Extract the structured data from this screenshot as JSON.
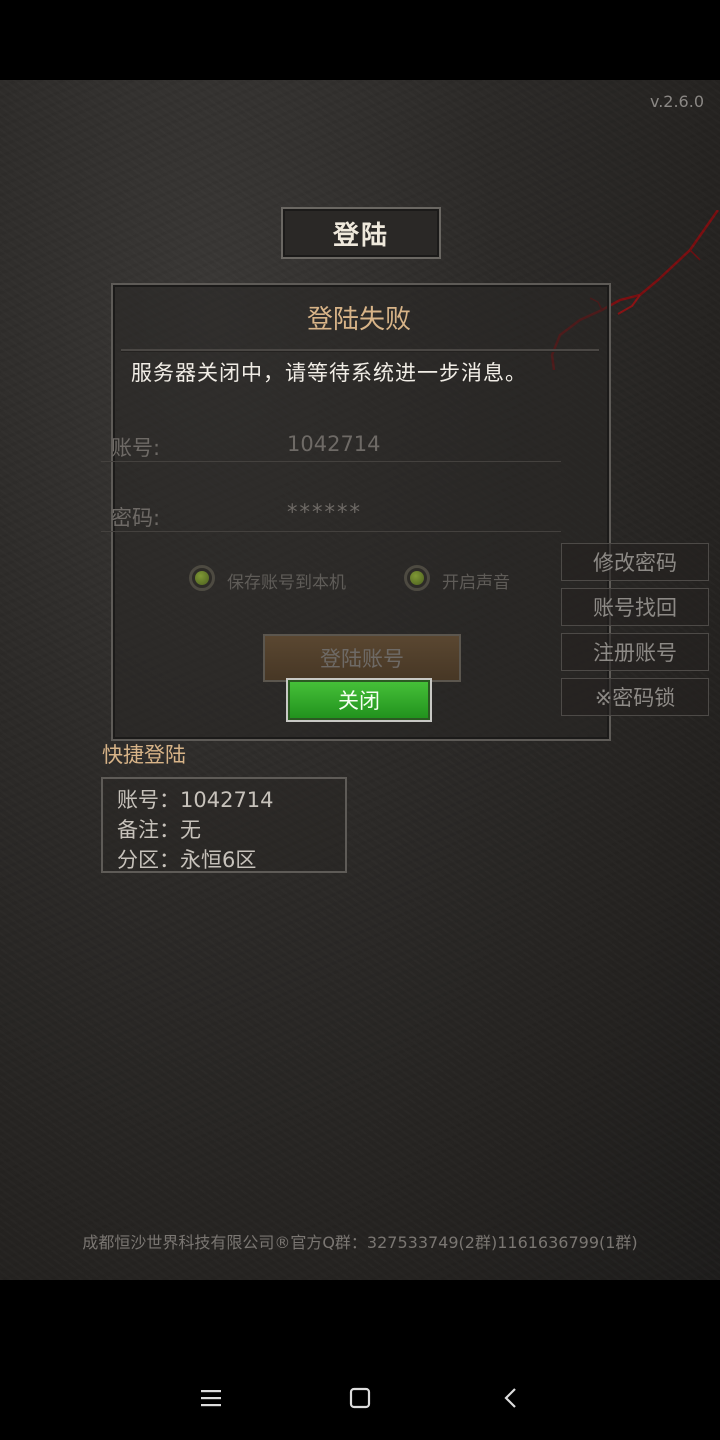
{
  "version": "v.2.6.0",
  "title": "登陆",
  "form": {
    "account_label": "账号:",
    "account_value": "1042714",
    "password_label": "密码:",
    "password_value": "******",
    "save_account_label": "保存账号到本机",
    "sound_label": "开启声音",
    "login_button": "登陆账号"
  },
  "side_buttons": {
    "change_password": "修改密码",
    "recover_account": "账号找回",
    "register": "注册账号",
    "password_lock": "※密码锁"
  },
  "dialog": {
    "title": "登陆失败",
    "message": "服务器关闭中，请等待系统进一步消息。",
    "close_button": "关闭"
  },
  "quick_login": {
    "title": "快捷登陆",
    "account": "账号：1042714",
    "note": "备注：无",
    "zone": "分区：永恒6区"
  },
  "footer": "成都恒沙世界科技有限公司®官方Q群：327533749(2群)1161636799(1群)",
  "colors": {
    "accent_gold": "#d8b488",
    "close_green": "#2fa82a"
  },
  "icons": {
    "nav_menu": "menu-icon",
    "nav_home": "home-icon",
    "nav_back": "back-icon"
  }
}
